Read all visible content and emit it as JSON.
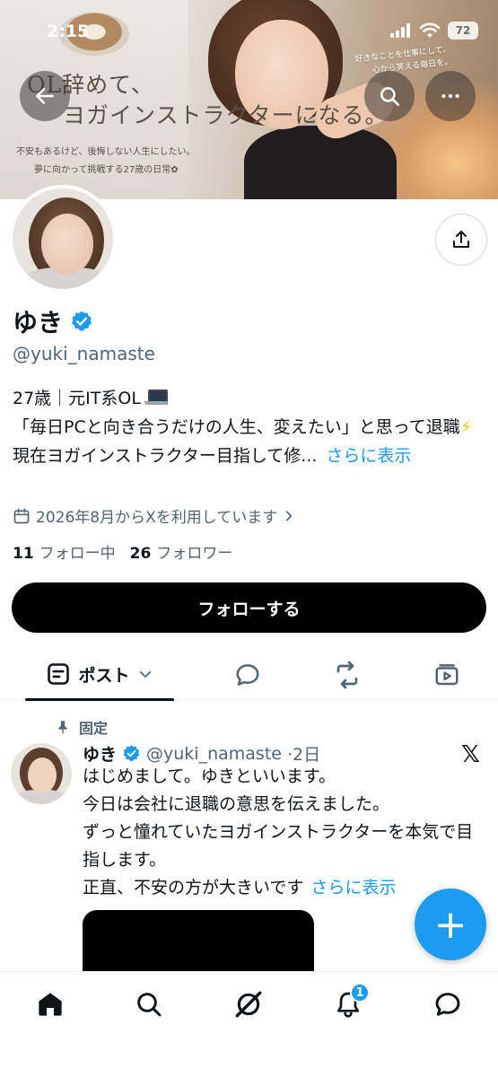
{
  "status_bar": {
    "time": "2:15",
    "battery": "72"
  },
  "banner": {
    "headline_line1": "OL辞めて、",
    "headline_line2": "ヨガインストラクターになる。",
    "sub_line1": "不安もあるけど、後悔しない人生にしたい。",
    "sub_line2": "夢に向かって挑戦する27歳の日常✿",
    "side_line1": "好きなことを仕事にして、",
    "side_line2": "心から笑える毎日を。"
  },
  "profile": {
    "name": "ゆき",
    "handle": "@yuki_namaste",
    "bio_line1": "27歳｜元IT系OL",
    "bio_line2": "「毎日PCと向き合うだけの人生、変えたい」と思って退職",
    "bio_line3": "現在ヨガインストラクター目指して修...",
    "bio_more": "さらに表示",
    "joined": "2026年8月からXを利用しています",
    "following_count": "11",
    "following_label": "フォロー中",
    "followers_count": "26",
    "followers_label": "フォロワー",
    "follow_button": "フォローする"
  },
  "tabs": {
    "posts_label": "ポスト"
  },
  "pinned_post": {
    "pinned_label": "固定",
    "author_name": "ゆき",
    "author_handle": "@yuki_namaste",
    "time": "·2日",
    "line1": "はじめまして。ゆきといいます。",
    "line2": "今日は会社に退職の意思を伝えました。",
    "line3": "ずっと憧れていたヨガインストラクターを本気で目指します。",
    "line4": "正直、不安の方が大きいです",
    "more": "さらに表示"
  },
  "fab": {
    "label": "+"
  },
  "bottom_nav": {
    "notification_count": "1"
  },
  "colors": {
    "accent": "#1d9bf0",
    "text": "#0f1419",
    "secondary": "#536471"
  }
}
